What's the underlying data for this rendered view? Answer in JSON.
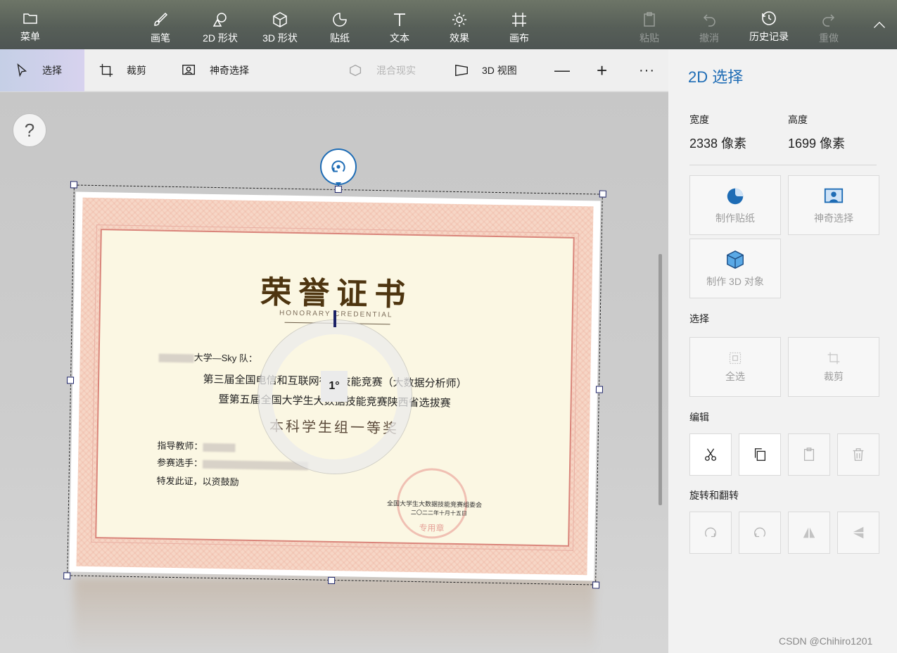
{
  "toolbar": {
    "menu": "菜单",
    "brush": "画笔",
    "shapes_2d": "2D 形状",
    "shapes_3d": "3D 形状",
    "sticker": "贴纸",
    "text": "文本",
    "effects": "效果",
    "canvas": "画布",
    "paste": "粘贴",
    "undo": "撤消",
    "history": "历史记录",
    "redo": "重做"
  },
  "subbar": {
    "select": "选择",
    "crop": "裁剪",
    "magic_select": "神奇选择",
    "mixed_reality": "混合现实",
    "view_3d": "3D 视图",
    "minus": "—",
    "plus": "+",
    "more": "···"
  },
  "canvas": {
    "help": "?",
    "rotation_readout": "1°",
    "rotation_degrees": 1
  },
  "certificate": {
    "title": "荣誉证书",
    "subtitle": "HONORARY CREDENTIAL",
    "team_suffix": "大学—Sky 队：",
    "line1": "第三届全国电信和互联网行业技能竞赛（大数据分析师）",
    "line2": "暨第五届全国大学生大数据技能竞赛陕西省选拔赛",
    "award": "本科学生组一等奖",
    "advisor_label": "指导教师：",
    "players_label": "参赛选手：",
    "closing": "特发此证，以资鼓励",
    "issuer": "全国大学生大数据技能竞赛组委会",
    "date": "二〇二二年十月十五日",
    "seal_text": "专用章"
  },
  "panel": {
    "title": "2D 选择",
    "width_label": "宽度",
    "width_value": "2338 像素",
    "height_label": "高度",
    "height_value": "1699 像素",
    "make_sticker": "制作贴纸",
    "magic_select": "神奇选择",
    "make_3d": "制作 3D 对象",
    "select_section": "选择",
    "select_all": "全选",
    "crop": "裁剪",
    "edit_section": "编辑",
    "rotate_flip_section": "旋转和翻转"
  },
  "watermark": "CSDN @Chihiro1201",
  "colors": {
    "accent": "#1e6cb5",
    "toolbar_bg": "#5a625b",
    "panel_bg": "#f2f2f2"
  }
}
